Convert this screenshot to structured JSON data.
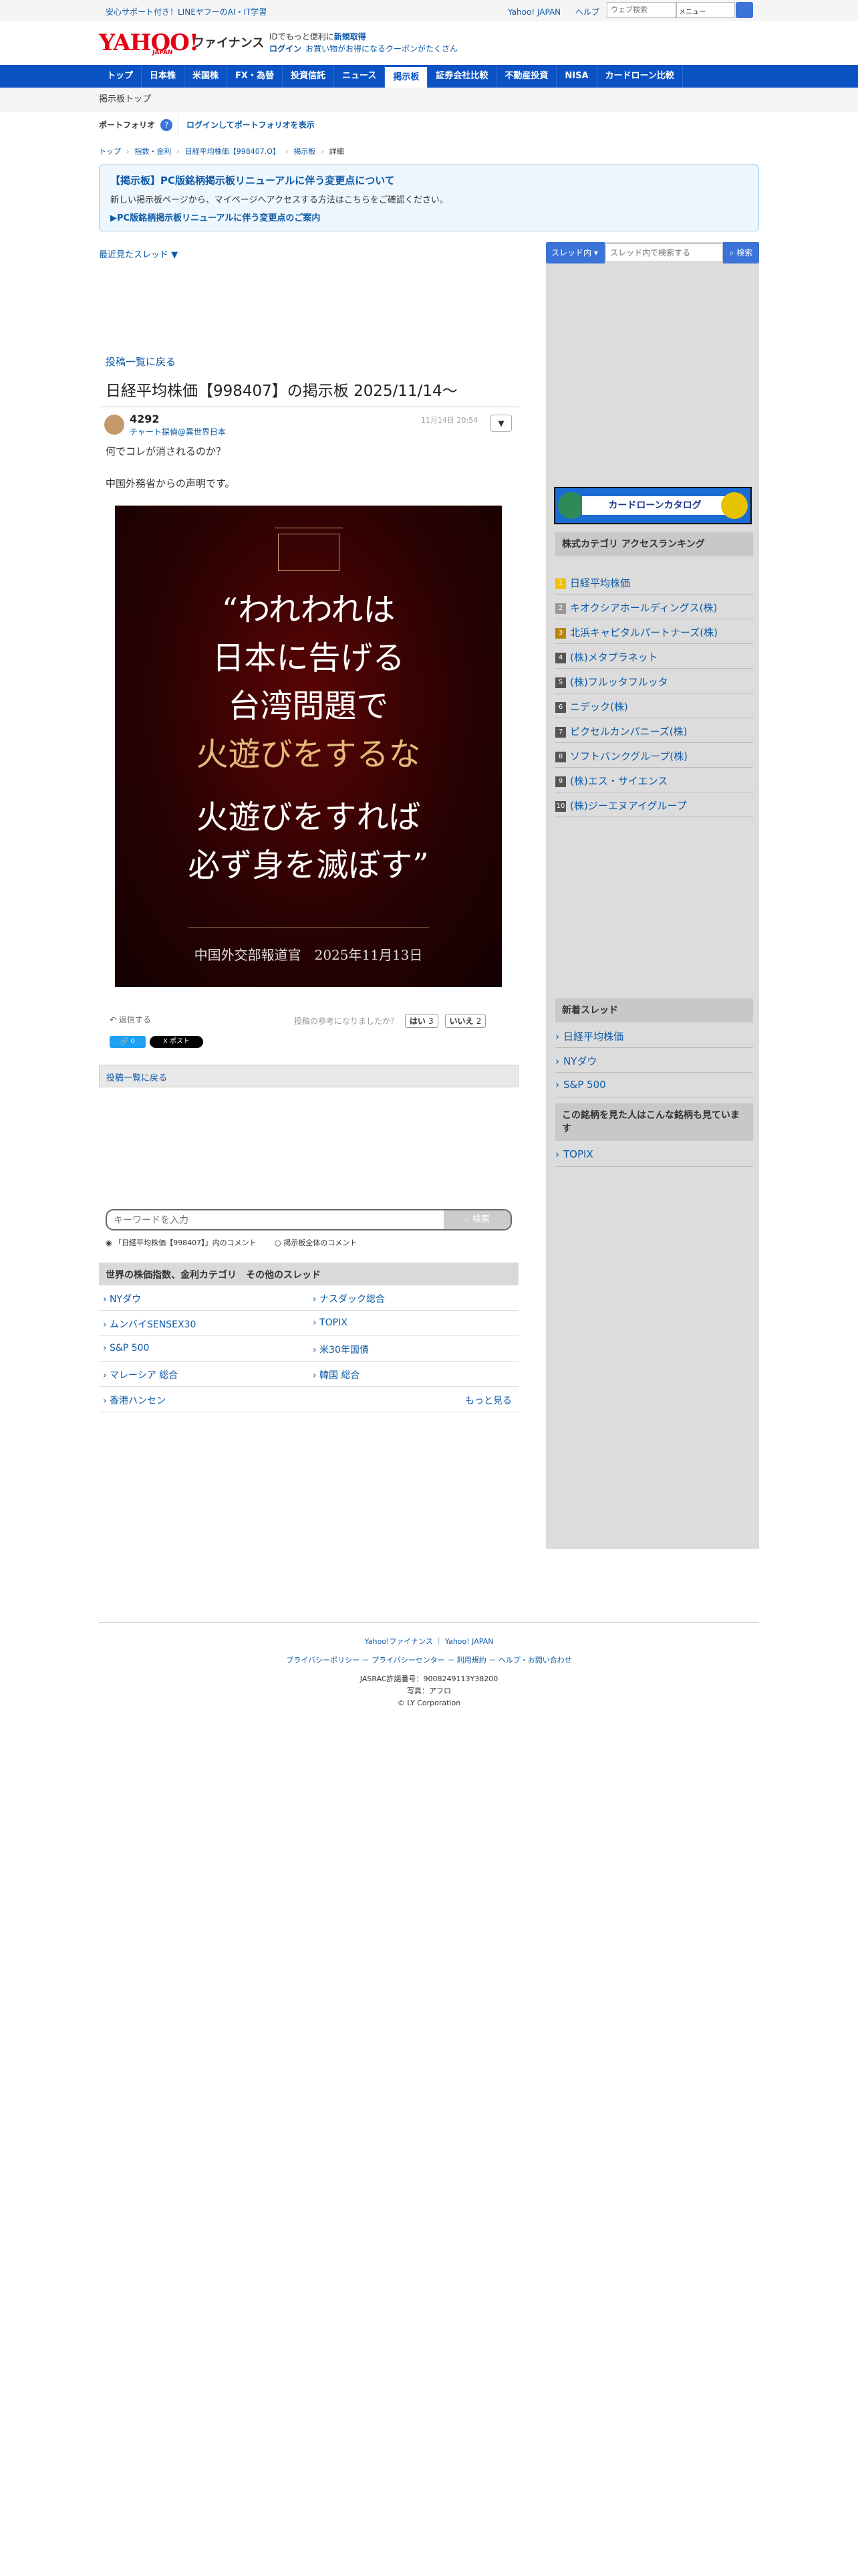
{
  "topbar": {
    "ad": "安心サポート付き！LINEヤフーのAI・IT学習",
    "yahoo_japan": "Yahoo! JAPAN",
    "help": "ヘルプ",
    "web_search_placeholder": "ウェブ検索",
    "mail": "メニュー",
    "search_icon": "search-icon"
  },
  "header": {
    "logo_brand": "YAHOO!",
    "logo_sub": "ファイナンス",
    "logo_japan": "JAPAN",
    "promo1": "IDでもっと便利に",
    "promo1_link": "新規取得",
    "login": "ログイン",
    "promo2": "お買い物がお得になるクーポンがたくさん"
  },
  "nav": [
    "トップ",
    "日本株",
    "米国株",
    "FX・為替",
    "投資信託",
    "ニュース",
    "掲示板",
    "証券会社比較",
    "不動産投資",
    "NISA",
    "カードローン比較"
  ],
  "subnav": {
    "label": "掲示板トップ"
  },
  "portfolio": {
    "label": "ポートフォリオ",
    "help": "?",
    "link": "ログインしてポートフォリオを表示"
  },
  "breadcrumb": [
    "トップ",
    "指数・金利",
    "日経平均株価【998407.O】",
    "掲示板",
    "詳細"
  ],
  "notice": {
    "title": "【掲示板】PC版銘柄掲示板リニューアルに伴う変更点について",
    "desc": "新しい掲示板ページから、マイページへアクセスする方法はこちらをご確認ください。",
    "link": "▶PC版銘柄掲示板リニューアルに伴う変更点のご案内"
  },
  "recent": "最近見たスレッド ▼",
  "thread": {
    "back": "投稿一覧に戻る",
    "title": "日経平均株価【998407】の掲示板 2025/11/14〜"
  },
  "post": {
    "number": "4292",
    "user": "チャート探偵@異世界日本",
    "date": "11月14日 20:54",
    "menu": "▼",
    "line1": "何でコレが消されるのか？",
    "line2": "中国外務省からの声明です。"
  },
  "poster": {
    "l1": "“われわれは",
    "l2": "日本に告げる",
    "l3": "台湾問題で",
    "l4": "火遊びをするな",
    "l5": "火遊びをすれば",
    "l6": "必ず身を滅ぼす”",
    "caption": "中国外交部報道官　2025年11月13日"
  },
  "actions": {
    "reply": "返信する",
    "helpful": "投稿の参考になりましたか？",
    "yes": "はい",
    "yes_count": "3",
    "no": "いいえ",
    "no_count": "2",
    "share_fb": "🔗 0",
    "share_x": "X ポスト"
  },
  "back2": "投稿一覧に戻る",
  "search": {
    "placeholder": "キーワードを入力",
    "button": "検索",
    "radio1": "「日経平均株価【998407】」内のコメント",
    "radio2": "掲示板全体のコメント"
  },
  "world": {
    "header": "世界の株価指数、金利カテゴリ　その他のスレッド",
    "items": [
      "NYダウ",
      "ナスダック総合",
      "ムンバイSENSEX30",
      "TOPIX",
      "S&P 500",
      "米30年国債",
      "マレーシア 総合",
      "韓国 総合",
      "香港ハンセン"
    ],
    "more": "もっと見る"
  },
  "sidebar": {
    "thread_btn": "スレッド内",
    "input_placeholder": "スレッド内で検索する",
    "search_btn": "検索",
    "banner": "カードローンカタログ",
    "ranking_title": "株式カテゴリ アクセスランキング",
    "ranking": [
      "日経平均株価",
      "キオクシアホールディングス(株)",
      "北浜キャピタルパートナーズ(株)",
      "(株)メタプラネット",
      "(株)フルッタフルッタ",
      "ニデック(株)",
      "ピクセルカンパニーズ(株)",
      "ソフトバンクグループ(株)",
      "(株)エス・サイエンス",
      "(株)ジーエヌアイグループ"
    ],
    "new_title": "新着スレッド",
    "new": [
      "日経平均株価",
      "NYダウ",
      "S&P 500"
    ],
    "also_title": "この銘柄を見た人はこんな銘柄も見ています",
    "also": [
      "TOPIX"
    ]
  },
  "footer": {
    "links1": "Yahoo!ファイナンス ｜ Yahoo! JAPAN",
    "links2": "プライバシーポリシー － プライバシーセンター － 利用規約 － ヘルプ・お問い合わせ",
    "jasrac": "JASRAC許諾番号：9008249113Y38200",
    "photo": "写真：アフロ",
    "copy": "© LY Corporation"
  }
}
